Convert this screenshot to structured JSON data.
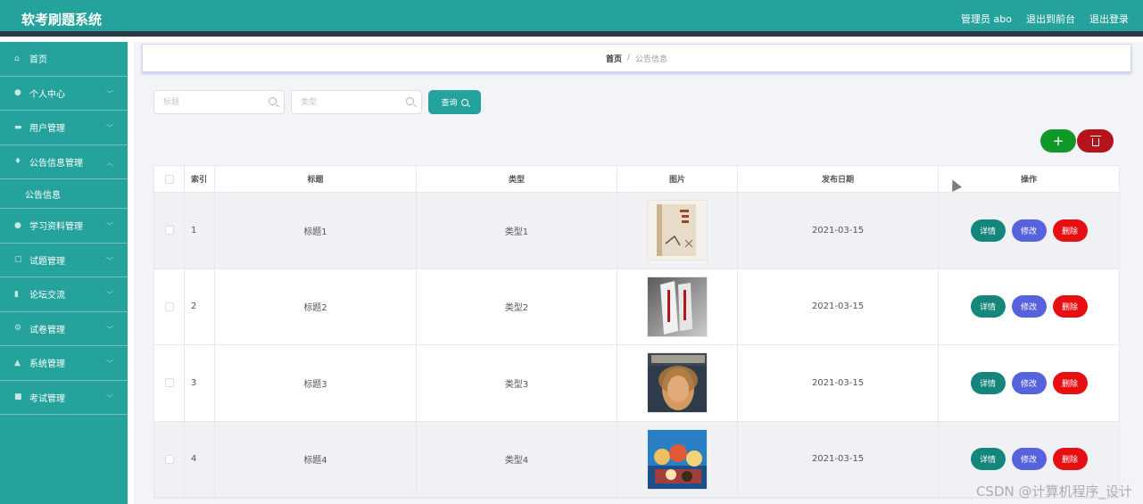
{
  "app": {
    "title": "软考刷题系统"
  },
  "header": {
    "user": "管理员 abo",
    "to_front": "退出到前台",
    "logout": "退出登录"
  },
  "sidebar": {
    "items": [
      {
        "label": "首页",
        "icon": "home-icon",
        "chevron": false
      },
      {
        "label": "个人中心",
        "icon": "user-icon",
        "chevron": true
      },
      {
        "label": "用户管理",
        "icon": "users-icon",
        "chevron": true
      },
      {
        "label": "公告信息管理",
        "icon": "mic-icon",
        "chevron": true,
        "expanded": true
      },
      {
        "label": "学习资料管理",
        "icon": "pin-icon",
        "chevron": true
      },
      {
        "label": "试题管理",
        "icon": "copy-icon",
        "chevron": true
      },
      {
        "label": "论坛交流",
        "icon": "chart-icon",
        "chevron": true
      },
      {
        "label": "试卷管理",
        "icon": "gear-icon",
        "chevron": true
      },
      {
        "label": "系统管理",
        "icon": "thumb-icon",
        "chevron": true
      },
      {
        "label": "考试管理",
        "icon": "doc-icon",
        "chevron": true
      }
    ],
    "sub_item": "公告信息"
  },
  "breadcrumb": {
    "home": "首页",
    "separator": "/",
    "current": "公告信息"
  },
  "search": {
    "title_placeholder": "标题",
    "type_placeholder": "类型",
    "query_label": "查询"
  },
  "actions": {
    "add_label": "+"
  },
  "table": {
    "headers": {
      "index": "索引",
      "title": "标题",
      "type": "类型",
      "image": "图片",
      "date": "发布日期",
      "ops": "操作"
    },
    "rows": [
      {
        "index": "1",
        "title": "标题1",
        "type": "类型1",
        "date": "2021-03-15"
      },
      {
        "index": "2",
        "title": "标题2",
        "type": "类型2",
        "date": "2021-03-15"
      },
      {
        "index": "3",
        "title": "标题3",
        "type": "类型3",
        "date": "2021-03-15"
      },
      {
        "index": "4",
        "title": "标题4",
        "type": "类型4",
        "date": "2021-03-15"
      }
    ],
    "ops": {
      "detail": "详情",
      "edit": "修改",
      "remove": "删除"
    }
  },
  "watermark": "CSDN @计算机程序_设计",
  "colors": {
    "primary": "#24a29b",
    "dark_bar": "#2c3747",
    "add": "#109829",
    "delete": "#b5141b",
    "edit": "#5763dc",
    "remove": "#e60f12",
    "detail": "#16857c"
  }
}
